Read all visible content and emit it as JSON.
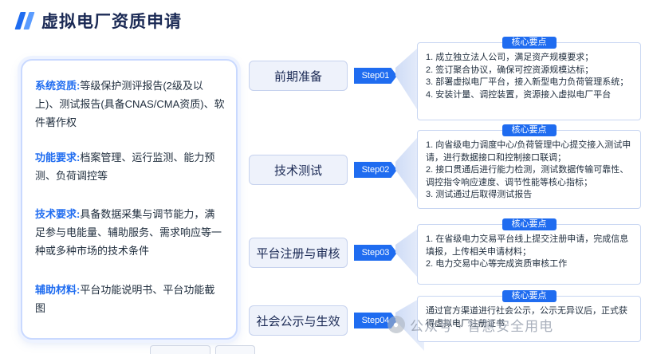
{
  "title": "虚拟电厂资质申请",
  "requirements": [
    {
      "key": "系统资质:",
      "text": "等级保护测评报告(2级及以上)、测试报告(具备CNAS/CMA资质)、软件著作权"
    },
    {
      "key": "功能要求:",
      "text": "档案管理、运行监测、能力预测、负荷调控等"
    },
    {
      "key": "技术要求:",
      "text": "具备数据采集与调节能力，满足参与电能量、辅助服务、需求响应等一种或多种市场的技术条件"
    },
    {
      "key": "辅助材料:",
      "text": "平台功能说明书、平台功能截图"
    }
  ],
  "stages": [
    {
      "name": "前期准备",
      "step": "Step01",
      "badge": "核心要点",
      "lines": [
        "1. 成立独立法人公司，满足资产规模要求；",
        "2. 签订聚合协议，确保可控资源规模达标；",
        "3. 部署虚拟电厂平台，接入新型电力负荷管理系统；",
        "4. 安装计量、调控装置，资源接入虚拟电厂平台"
      ]
    },
    {
      "name": "技术测试",
      "step": "Step02",
      "badge": "核心要点",
      "lines": [
        "1. 向省级电力调度中心/负荷管理中心提交接入测试申请，进行数据接口和控制接口联调；",
        "2. 接口贯通后进行能力检测，测试数据传输可靠性、调控指令响应速度、调节性能等核心指标；",
        "3. 测试通过后取得测试报告"
      ]
    },
    {
      "name": "平台注册与审核",
      "step": "Step03",
      "badge": "核心要点",
      "lines": [
        "1. 在省级电力交易平台线上提交注册申请，完成信息填报，上传相关申请材料；",
        "2. 电力交易中心等完成资质审核工作"
      ]
    },
    {
      "name": "社会公示与生效",
      "step": "Step04",
      "badge": "核心要点",
      "lines": [
        "通过官方渠道进行社会公示，公示无异议后，正式获得虚拟电厂注册证书"
      ]
    }
  ],
  "watermark": "公众号 · 智慧安全用电",
  "icons": {
    "watermark": "wechat-icon",
    "title_mark": "double-slash-icon"
  },
  "colors": {
    "accent": "#1f6cf0",
    "stage_bg": "#eef2fb",
    "title": "#1b2a55"
  }
}
